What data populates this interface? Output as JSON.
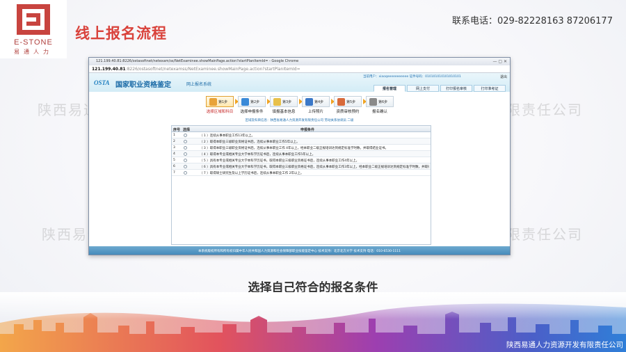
{
  "logo": {
    "text_en": "E-STONE",
    "text_cn": "易通人力"
  },
  "slide": {
    "title": "线上报名流程",
    "phone": "联系电话：029-82228163 87206177",
    "caption": "选择自己符合的报名条件",
    "watermark_left": "陕西易通",
    "watermark_right": "限责任公司",
    "footer_company": "陕西易通人力资源开发有限责任公司"
  },
  "browser": {
    "window_title": "121.199.40.81:8226/ostasoftnet/netexam/ss/NetExaminee.showMainPage.action?startPlanItemId= - Google Chrome",
    "address_host": "121.199.40.81",
    "address_path": ":8226/ostasoftnet/netexamss/NetExaminee.showMainPage.action?startPlanItemId=",
    "site": {
      "logo": "OSTA",
      "name": "国家职业资格鉴定",
      "subtitle": "网上报名系统",
      "user_line": "当前用户：xiaoqeeeeeeeeeee 证件号码：010101010101010101",
      "help": "退出",
      "tabs": [
        "报名管理",
        "网上支付",
        "打印报名审核",
        "打印准考证"
      ]
    },
    "steps": [
      {
        "num": "第1步",
        "label": "选择区域和科目",
        "color": "#e8a33a"
      },
      {
        "num": "第2步",
        "label": "选择申报条件",
        "color": "#3a8ad8"
      },
      {
        "num": "第3步",
        "label": "填报基本信息",
        "color": "#e8c04a"
      },
      {
        "num": "第4步",
        "label": "上传照片",
        "color": "#3a78c8"
      },
      {
        "num": "第5步",
        "label": "资质审核预约",
        "color": "#d86a3a"
      },
      {
        "num": "第6步",
        "label": "报名确认",
        "color": "#8a8a8a"
      }
    ],
    "notice": "区域及科目信息：陕西省易通人力资源开发有限责任公司  劳动关系协调员  二级",
    "grid": {
      "headers": [
        "序号",
        "选择",
        "申报条件"
      ],
      "rows": [
        {
          "idx": "1",
          "text": "（ 1 ）连续从事本职业工作13年以上。"
        },
        {
          "idx": "2",
          "text": "（ 2 ）取得本职业三级职业资格证书后，连续从事本职业工作5年以上。"
        },
        {
          "idx": "3",
          "text": "（ 3 ）取得本职业三级职业资格证书后，连续从事本职业工作 4年以上，经本职业二级正规培训达到规定标准学时数，并取得结业证书。"
        },
        {
          "idx": "4",
          "text": "（ 4 ）取得本专业或相关专业大学本科学历证书后，连续从事本职业工作5年以上。"
        },
        {
          "idx": "5",
          "text": "（ 5 ）具有本专业或相关专业大学本科学历证书，取得本职业三级职业资格证书后，连续从事本职业工作4年以上。"
        },
        {
          "idx": "6",
          "text": "（ 6 ）具有本专业或相关专业大学本科学历证书，取得本职业三级职业资格证书后，连续从事本职业工作3年以上，经本职业二级正规培训达到规定标准学时数，并取得结业..."
        },
        {
          "idx": "7",
          "text": "（ 7 ）取得硕士研究生及以上学历证书后，连续从事本职业工作 2年以上。"
        }
      ]
    },
    "footer": "本系统版权所有和所有权归属中华人民共和国人力资源和社会保障部职业技能鉴定中心   技术支持：北京北方大学 技术支持   电话：010-6530-1111"
  },
  "colors": {
    "title_red": "#d9423b",
    "link_blue": "#1e6fb0",
    "footer_blue": "#3f86b8"
  }
}
